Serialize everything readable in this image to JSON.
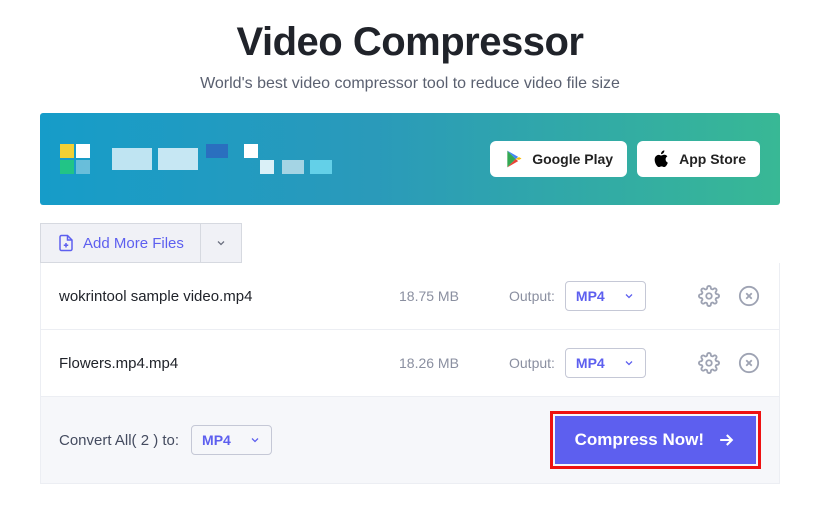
{
  "header": {
    "title": "Video Compressor",
    "subtitle": "World's best video compressor tool to reduce video file size"
  },
  "banner": {
    "google_play": "Google Play",
    "app_store": "App Store"
  },
  "toolbar": {
    "add_more_files": "Add More Files"
  },
  "files": [
    {
      "name": "wokrintool sample video.mp4",
      "size": "18.75 MB",
      "output_label": "Output:",
      "format": "MP4"
    },
    {
      "name": "Flowers.mp4.mp4",
      "size": "18.26 MB",
      "output_label": "Output:",
      "format": "MP4"
    }
  ],
  "footer": {
    "convert_all_label": "Convert All( 2 ) to:",
    "format": "MP4",
    "compress_label": "Compress Now!"
  }
}
